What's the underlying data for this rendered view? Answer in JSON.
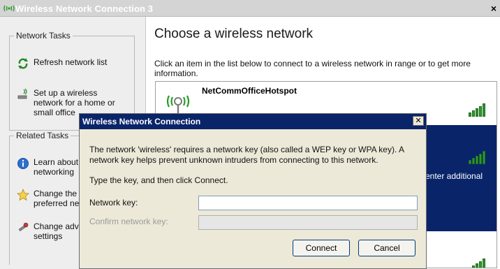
{
  "window": {
    "title": "Wireless Network Connection 3",
    "close_label": "×"
  },
  "left_panel": {
    "network_tasks": {
      "title": "Network Tasks",
      "items": [
        {
          "label": "Refresh network list",
          "icon": "refresh-icon"
        },
        {
          "label": "Set up a wireless network for a home or small office",
          "icon": "wireless-setup-icon"
        }
      ]
    },
    "related_tasks": {
      "title": "Related Tasks",
      "items": [
        {
          "label": "Learn about wireless networking",
          "icon": "info-icon",
          "visible_text": [
            "Learn about",
            "networking"
          ]
        },
        {
          "label": "Change the order of preferred networks",
          "icon": "star-icon",
          "visible_text": [
            "Change the",
            "preferred ne"
          ]
        },
        {
          "label": "Change advanced settings",
          "icon": "settings-icon",
          "visible_text": [
            "Change adv",
            "settings"
          ]
        }
      ]
    }
  },
  "main": {
    "title": "Choose a wireless network",
    "intro_text": "Click an item in the list below to connect to a wireless network in range or to get more information.",
    "networks": [
      {
        "name": "NetCommOfficeHotspot",
        "signal_bars": 5,
        "selected": false
      },
      {
        "name": "",
        "signal_bars": 5,
        "selected": true,
        "partial_text": "enter additional"
      },
      {
        "name": "",
        "signal_bars": 5,
        "selected": false
      }
    ]
  },
  "dialog": {
    "title": "Wireless Network Connection",
    "close_label": "✕",
    "message": "The network 'wireless' requires a network key (also called a WEP key or WPA key). A network key helps prevent unknown intruders from connecting to this network.",
    "instruction": "Type the key, and then click Connect.",
    "network_key_label": "Network key:",
    "network_key_value": "",
    "confirm_key_label": "Confirm network key:",
    "confirm_key_value": "",
    "connect_label": "Connect",
    "cancel_label": "Cancel"
  },
  "colors": {
    "selection_blue": "#0a246a",
    "signal_green": "#2a9b2a",
    "dialog_bg": "#ece9d8"
  }
}
